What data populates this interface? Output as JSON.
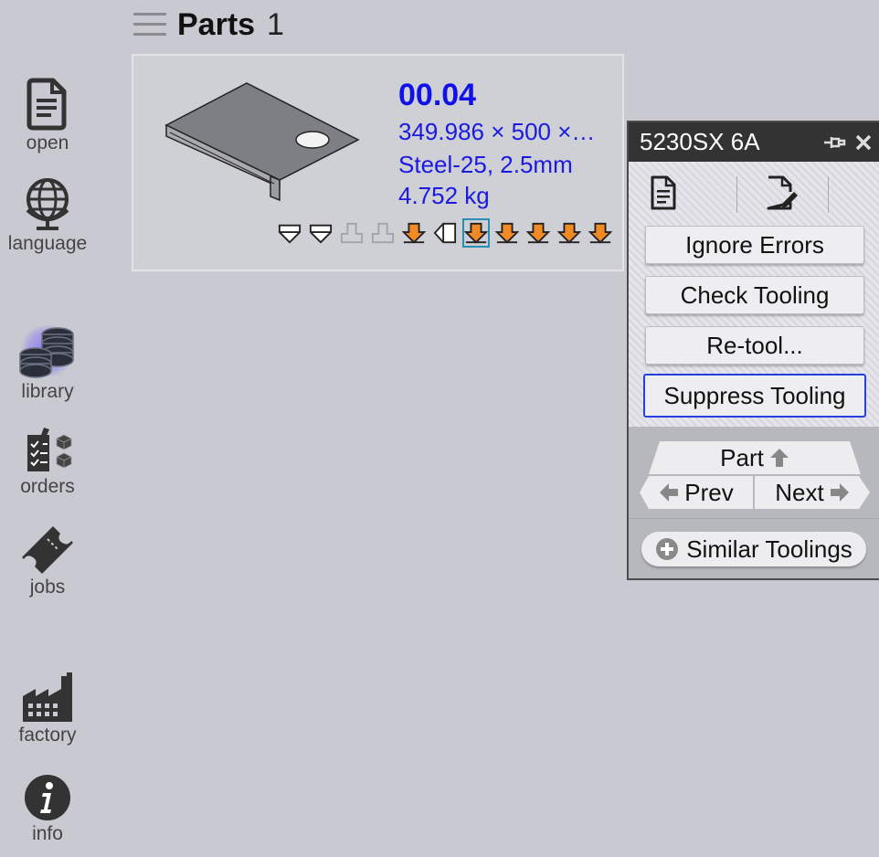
{
  "sidebar": {
    "items": [
      {
        "label": "open",
        "icon": "document-icon"
      },
      {
        "label": "language",
        "icon": "globe-icon"
      },
      {
        "label": "library",
        "icon": "coins-stack-icon",
        "active": true
      },
      {
        "label": "orders",
        "icon": "checklist-icon"
      },
      {
        "label": "jobs",
        "icon": "ticket-icon"
      },
      {
        "label": "factory",
        "icon": "factory-icon"
      },
      {
        "label": "info",
        "icon": "info-icon"
      }
    ]
  },
  "header": {
    "title": "Parts",
    "count": "1"
  },
  "part": {
    "id": "00.04",
    "dimensions": "349.986 × 500 ×…",
    "material": "Steel-25, 2.5mm",
    "weight": "4.752 kg",
    "bend_ops": [
      "up",
      "up",
      "disabled",
      "disabled",
      "orange",
      "left",
      "orange-selected",
      "orange",
      "orange",
      "orange",
      "orange"
    ]
  },
  "panel": {
    "title": "5230SX 6A",
    "buttons": {
      "ignore_errors": "Ignore Errors",
      "check_tooling": "Check Tooling",
      "retool": "Re-tool...",
      "suppress_tooling": "Suppress Tooling"
    },
    "nav": {
      "part": "Part",
      "prev": "Prev",
      "next": "Next"
    },
    "similar": "Similar Toolings"
  },
  "colors": {
    "accent_blue": "#1a1ae0",
    "orange": "#f08a24",
    "focus_border": "#2540e0",
    "highlight": "#2a8fb8"
  }
}
